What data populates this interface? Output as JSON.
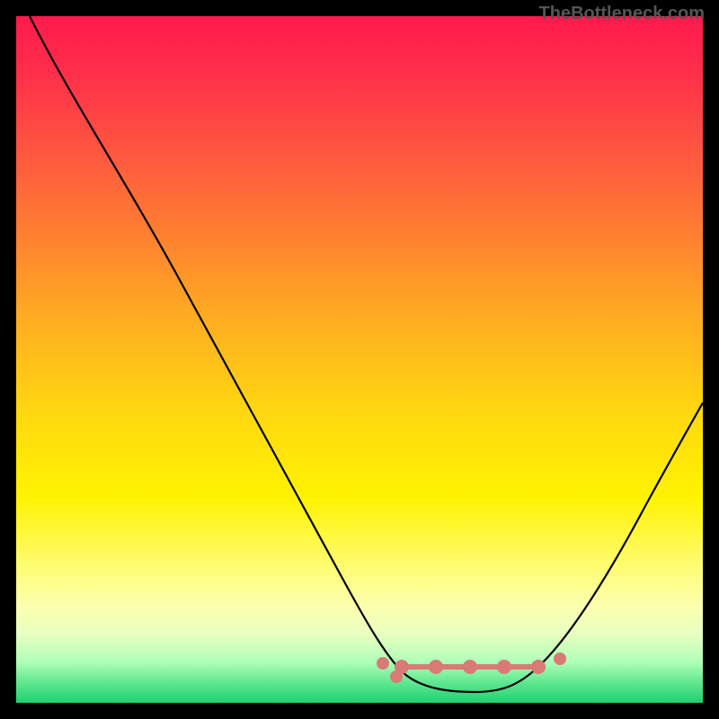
{
  "watermark": "TheBottleneck.com",
  "chart_data": {
    "type": "line",
    "title": "",
    "xlabel": "",
    "ylabel": "",
    "xlim": [
      0,
      100
    ],
    "ylim": [
      0,
      100
    ],
    "background": "rainbow-vertical-gradient",
    "series": [
      {
        "name": "bottleneck-curve",
        "x": [
          2,
          10,
          20,
          30,
          40,
          50,
          55,
          58,
          62,
          66,
          70,
          74,
          78,
          82,
          90,
          100
        ],
        "y": [
          100,
          88,
          74,
          60,
          46,
          26,
          14,
          8,
          4,
          3,
          3,
          4,
          8,
          16,
          32,
          54
        ],
        "color": "#000000"
      }
    ],
    "markers": {
      "name": "optimal-range",
      "color": "#d97a77",
      "x": [
        55,
        58,
        62,
        66,
        70,
        74,
        78
      ],
      "y": [
        8,
        6,
        4,
        3,
        3,
        4,
        6
      ]
    }
  }
}
